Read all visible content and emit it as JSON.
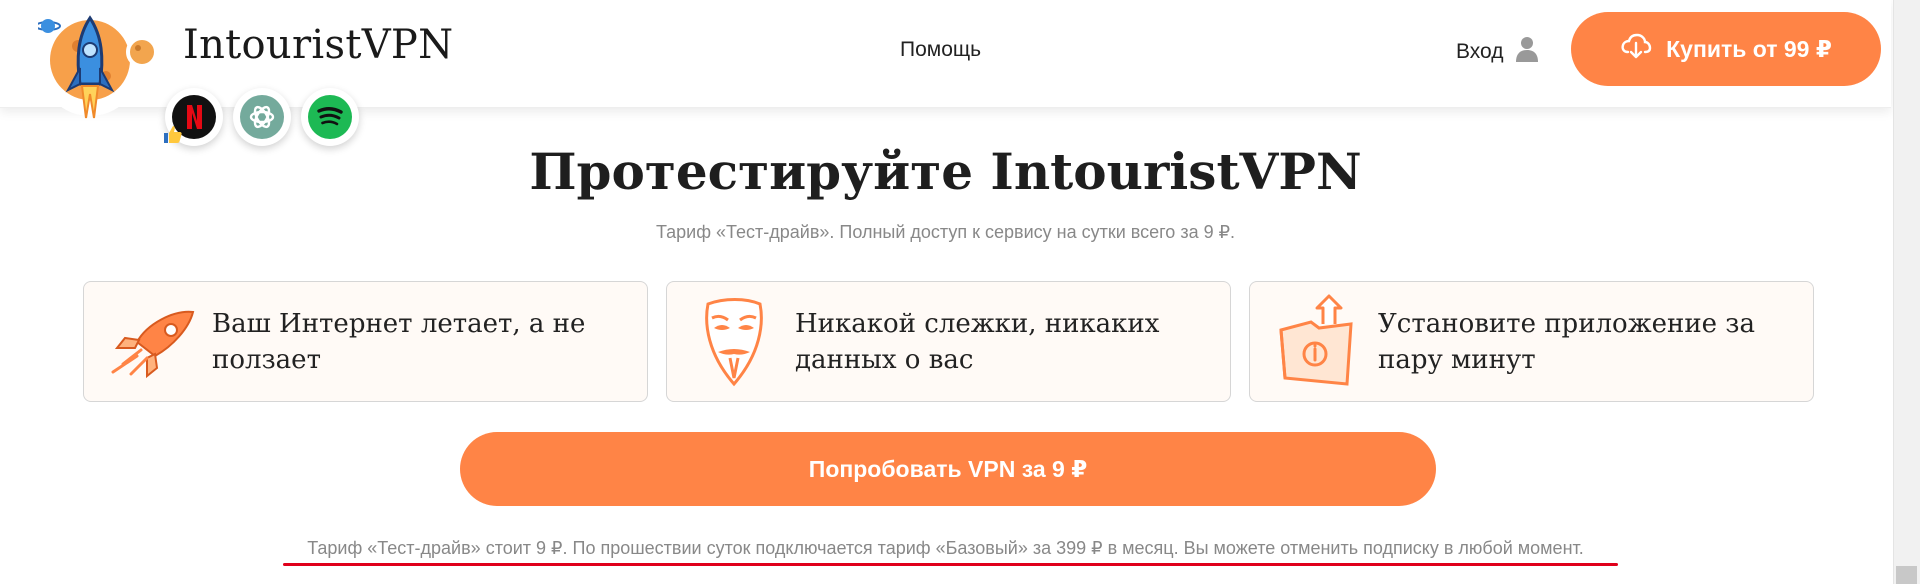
{
  "header": {
    "brand": "IntouristVPN",
    "nav": {
      "help": "Помощь"
    },
    "login": {
      "label": "Вход",
      "icon": "user-icon"
    },
    "buy_button": {
      "label": "Купить от 99 ₽",
      "icon": "cloud-download-icon"
    },
    "services": [
      "netflix-icon",
      "chatgpt-icon",
      "spotify-icon"
    ]
  },
  "main": {
    "title": "Протестируйте IntouristVPN",
    "subtitle": "Тариф «Тест-драйв». Полный доступ к сервису на сутки всего за 9 ₽.",
    "features": [
      {
        "icon": "rocket-icon",
        "text": "Ваш Интернет летает, а не ползает"
      },
      {
        "icon": "mask-icon",
        "text": "Никакой слежки, никаких данных о вас"
      },
      {
        "icon": "install-folder-icon",
        "text": "Установите приложение за пару минут"
      }
    ],
    "try_button": "Попробовать VPN за 9 ₽",
    "note": "Тариф «Тест-драйв» стоит 9 ₽. По прошествии суток подключается тариф «Базовый» за 399 ₽ в месяц. Вы можете отменить подписку в любой момент."
  },
  "colors": {
    "accent": "#ff8446",
    "underline": "#e0001b"
  }
}
